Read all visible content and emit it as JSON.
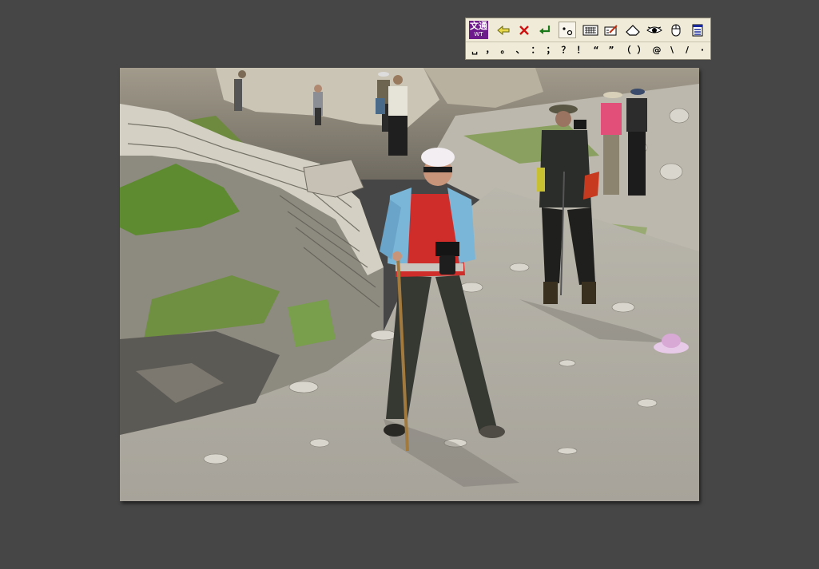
{
  "ime": {
    "logo_line1": "文通",
    "logo_line2": "WT",
    "buttons": [
      {
        "name": "back-arrow-icon"
      },
      {
        "name": "delete-x-icon"
      },
      {
        "name": "enter-icon"
      },
      {
        "name": "punctuation-mode-icon"
      },
      {
        "name": "soft-keyboard-icon"
      },
      {
        "name": "handwriting-icon"
      },
      {
        "name": "eraser-icon"
      },
      {
        "name": "eye-icon"
      },
      {
        "name": "mouse-icon"
      },
      {
        "name": "menu-icon"
      }
    ],
    "punctuation": [
      "␣",
      "，",
      "。",
      "、",
      "：",
      "；",
      "？",
      "！",
      "“",
      "”",
      "（",
      "）",
      "@",
      "\\",
      "/",
      "·"
    ]
  },
  "photo": {
    "subject": "hikers"
  }
}
